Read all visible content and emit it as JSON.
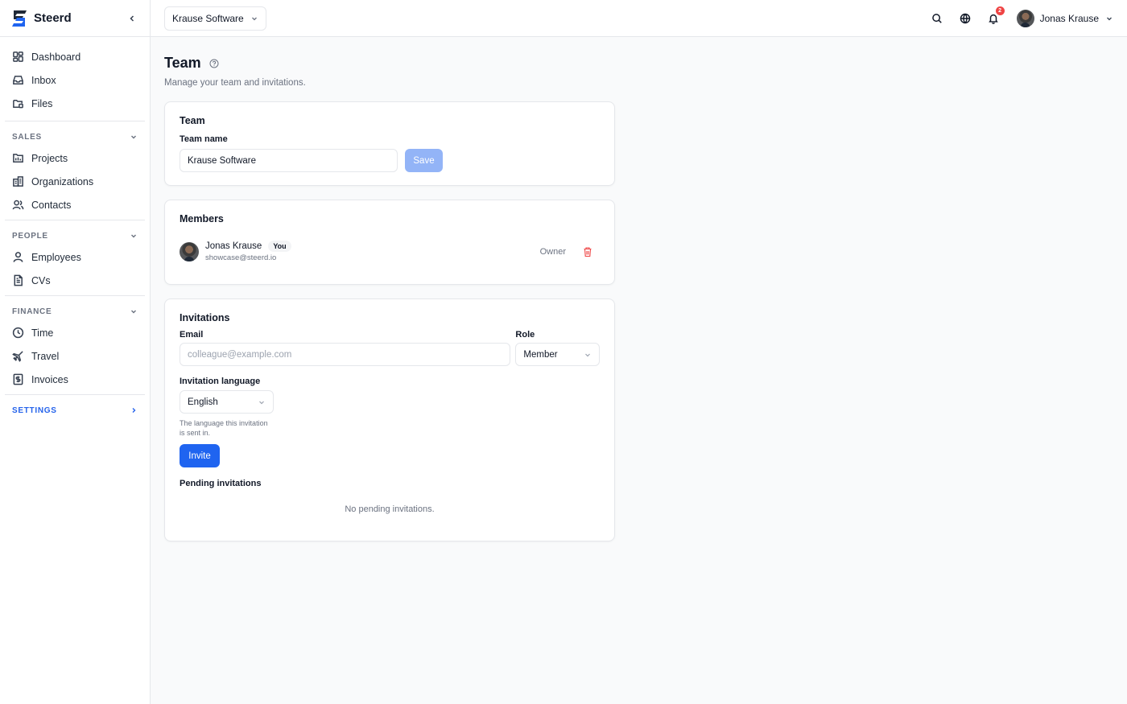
{
  "brand": {
    "name": "Steerd",
    "accent": "#1f64f0"
  },
  "sidebar": {
    "top_items": [
      {
        "label": "Dashboard",
        "icon": "dashboard-icon"
      },
      {
        "label": "Inbox",
        "icon": "inbox-icon"
      },
      {
        "label": "Files",
        "icon": "files-icon"
      }
    ],
    "sections": [
      {
        "label": "SALES",
        "items": [
          {
            "label": "Projects",
            "icon": "projects-icon"
          },
          {
            "label": "Organizations",
            "icon": "organizations-icon"
          },
          {
            "label": "Contacts",
            "icon": "contacts-icon"
          }
        ]
      },
      {
        "label": "PEOPLE",
        "items": [
          {
            "label": "Employees",
            "icon": "employees-icon"
          },
          {
            "label": "CVs",
            "icon": "cvs-icon"
          }
        ]
      },
      {
        "label": "FINANCE",
        "items": [
          {
            "label": "Time",
            "icon": "clock-icon"
          },
          {
            "label": "Travel",
            "icon": "plane-icon"
          },
          {
            "label": "Invoices",
            "icon": "invoice-icon"
          }
        ]
      }
    ],
    "settings_label": "SETTINGS"
  },
  "topbar": {
    "org": "Krause Software",
    "notifications_count": "2",
    "user_name": "Jonas Krause"
  },
  "page": {
    "title": "Team",
    "subtitle": "Manage your team and invitations."
  },
  "team_card": {
    "title": "Team",
    "name_label": "Team name",
    "name_value": "Krause Software",
    "save_label": "Save"
  },
  "members_card": {
    "title": "Members",
    "members": [
      {
        "name": "Jonas Krause",
        "tag": "You",
        "email": "showcase@steerd.io",
        "role": "Owner"
      }
    ]
  },
  "invitations_card": {
    "title": "Invitations",
    "email_label": "Email",
    "email_placeholder": "colleague@example.com",
    "role_label": "Role",
    "role_value": "Member",
    "language_label": "Invitation language",
    "language_value": "English",
    "language_hint": "The language this invitation is sent in.",
    "invite_label": "Invite",
    "pending_label": "Pending invitations",
    "empty_text": "No pending invitations."
  }
}
